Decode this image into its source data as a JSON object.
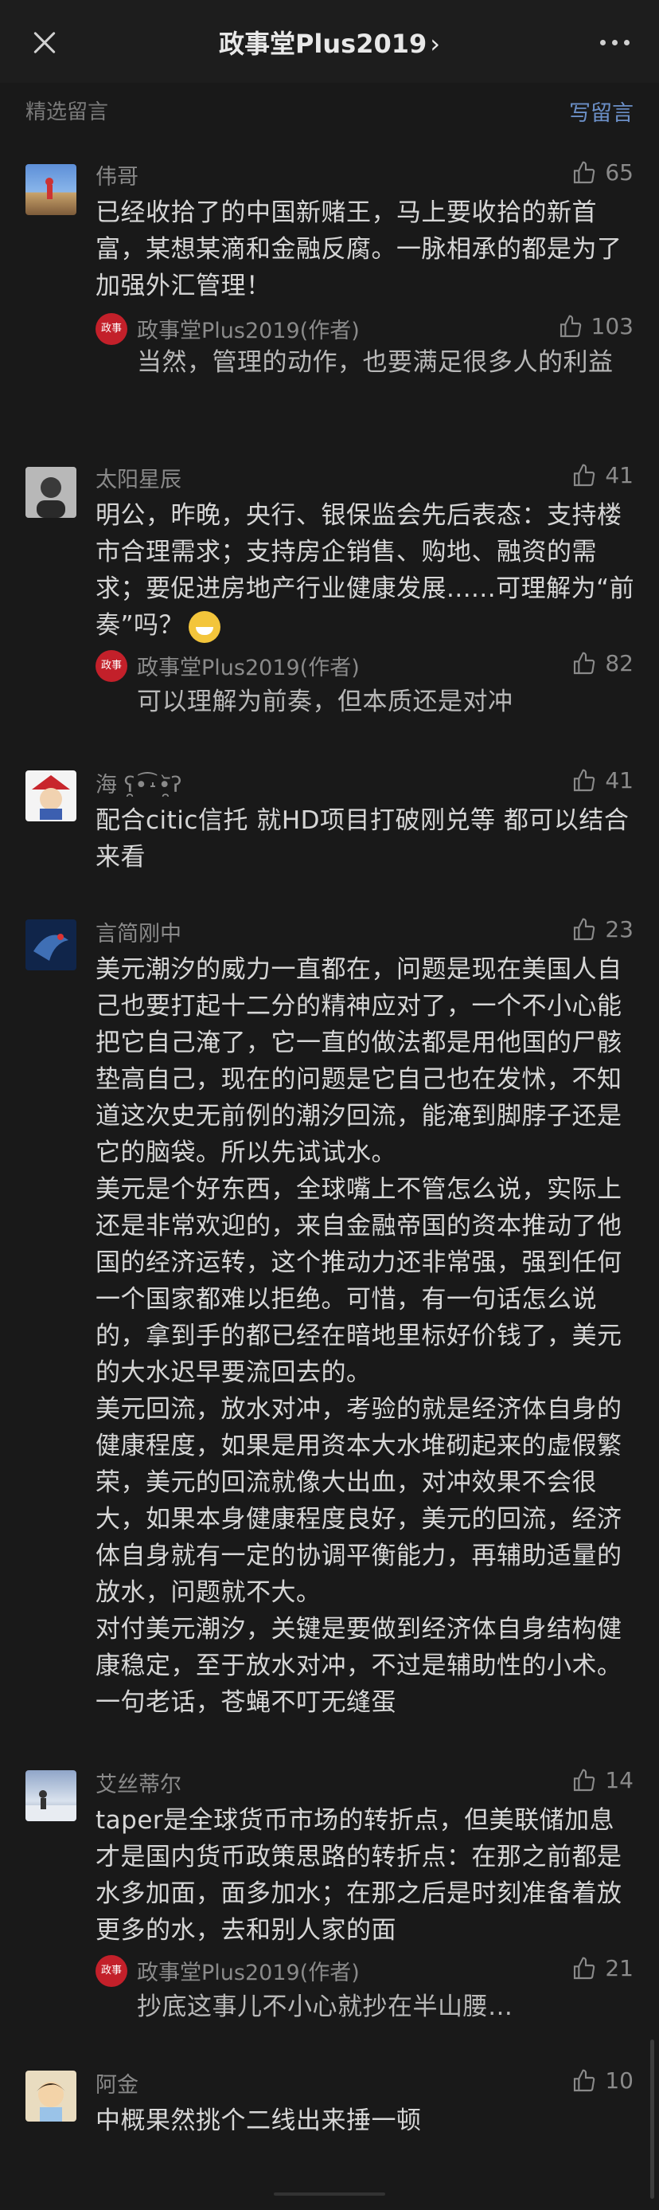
{
  "header": {
    "title": "政事堂Plus2019",
    "chevron": "›",
    "close_icon": "close-icon",
    "more_icon": "more-icon"
  },
  "section": {
    "title": "精选留言",
    "write_label": "写留言"
  },
  "colors": {
    "background": "#191919",
    "accent": "#6b8fc7",
    "author_badge": "#c3202a"
  },
  "comments": [
    {
      "name": "伟哥",
      "likes": "65",
      "text": "已经收拾了的中国新赌王，马上要收拾的新首富，某想某滴和金融反腐。一脉相承的都是为了加强外汇管理！",
      "reply": {
        "name": "政事堂Plus2019(作者)",
        "likes": "103",
        "text": "当然，管理的动作，也要满足很多人的利益"
      }
    },
    {
      "name": "太阳星辰",
      "likes": "41",
      "text": "明公，昨晚，央行、银保监会先后表态：支持楼市合理需求；支持房企销售、购地、融资的需求；要促进房地产行业健康发展......可理解为“前奏”吗？",
      "reply": {
        "name": "政事堂Plus2019(作者)",
        "likes": "82",
        "text": "可以理解为前奏，但本质还是对冲"
      }
    },
    {
      "name": "海 ʕ̯•͡˔•̯᷅ʔ",
      "likes": "41",
      "text": "配合citic信托 就HD项目打破刚兑等 都可以结合来看"
    },
    {
      "name": "言简刚中",
      "likes": "23",
      "text": "美元潮汐的威力一直都在，问题是现在美国人自己也要打起十二分的精神应对了，一个不小心能把它自己淹了，它一直的做法都是用他国的尸骸垫高自己，现在的问题是它自己也在发怵，不知道这次史无前例的潮汐回流，能淹到脚脖子还是它的脑袋。所以先试试水。\n美元是个好东西，全球嘴上不管怎么说，实际上还是非常欢迎的，来自金融帝国的资本推动了他国的经济运转，这个推动力还非常强，强到任何一个国家都难以拒绝。可惜，有一句话怎么说的，拿到手的都已经在暗地里标好价钱了，美元的大水迟早要流回去的。\n美元回流，放水对冲，考验的就是经济体自身的健康程度，如果是用资本大水堆砌起来的虚假繁荣，美元的回流就像大出血，对冲效果不会很大，如果本身健康程度良好，美元的回流，经济体自身就有一定的协调平衡能力，再辅助适量的放水，问题就不大。\n对付美元潮汐，关键是要做到经济体自身结构健康稳定，至于放水对冲，不过是辅助性的小术。\n一句老话，苍蝇不叮无缝蛋"
    },
    {
      "name": "艾丝蒂尔",
      "likes": "14",
      "text": "taper是全球货币市场的转折点，但美联储加息才是国内货币政策思路的转折点：在那之前都是水多加面，面多加水；在那之后是时刻准备着放更多的水，去和别人家的面",
      "reply": {
        "name": "政事堂Plus2019(作者)",
        "likes": "21",
        "text": "抄底这事儿不小心就抄在半山腰…"
      }
    },
    {
      "name": "阿金",
      "likes": "10",
      "text": "中概果然挑个二线出来捶一顿"
    }
  ]
}
